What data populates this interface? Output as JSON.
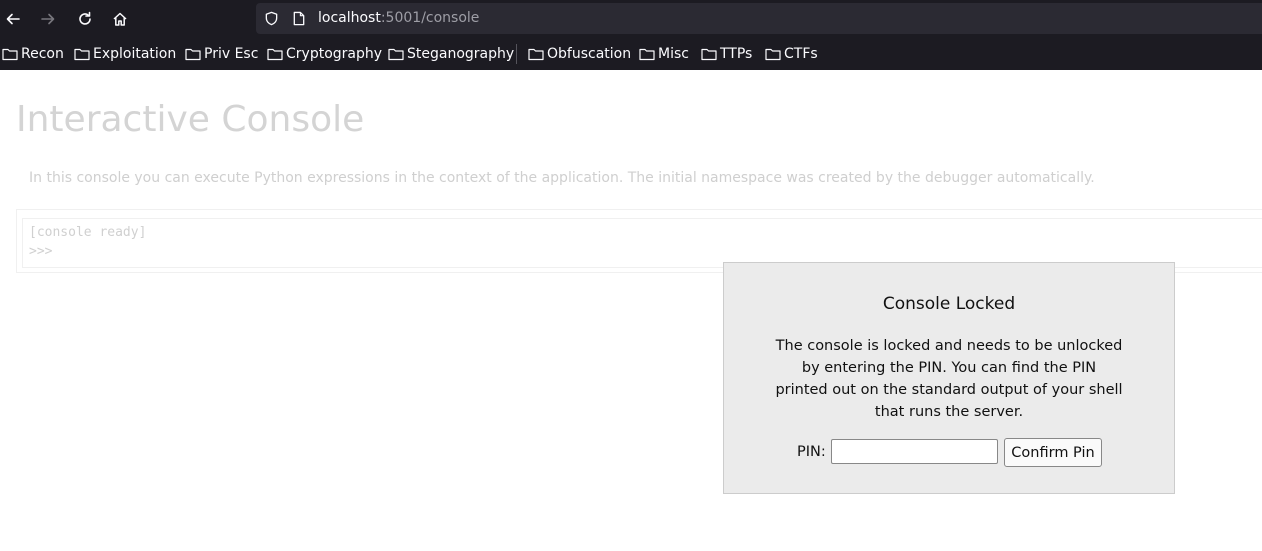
{
  "browser": {
    "url_host": "localhost",
    "url_path": ":5001/console",
    "icons": [
      "back-arrow-icon",
      "forward-arrow-icon",
      "reload-icon",
      "home-icon",
      "shield-icon",
      "page-icon",
      "folder-icon"
    ],
    "bookmarks": [
      {
        "label": "Recon"
      },
      {
        "label": "Exploitation"
      },
      {
        "label": "Priv Esc"
      },
      {
        "label": "Cryptography"
      },
      {
        "label": "Steganography"
      },
      {
        "label": "Obfuscation"
      },
      {
        "label": "Misc"
      },
      {
        "label": "TTPs"
      },
      {
        "label": "CTFs"
      }
    ]
  },
  "page": {
    "title": "Interactive Console",
    "intro": "In this console you can execute Python expressions in the context of the application. The initial namespace was created by the debugger automatically.",
    "console_lines": [
      "[console ready]",
      ">>>"
    ]
  },
  "pin_dialog": {
    "title": "Console Locked",
    "message": "The console is locked and needs to be unlocked by entering the PIN. You can find the PIN printed out on the standard output of your shell that runs the server.",
    "pin_label": "PIN:",
    "pin_value": "",
    "confirm_label": "Confirm Pin"
  },
  "colors": {
    "chrome_bg": "#1c1b22",
    "urlbar_bg": "#2b2a33",
    "dialog_bg": "#ebebeb",
    "faded_text": "#d4d4d4"
  }
}
